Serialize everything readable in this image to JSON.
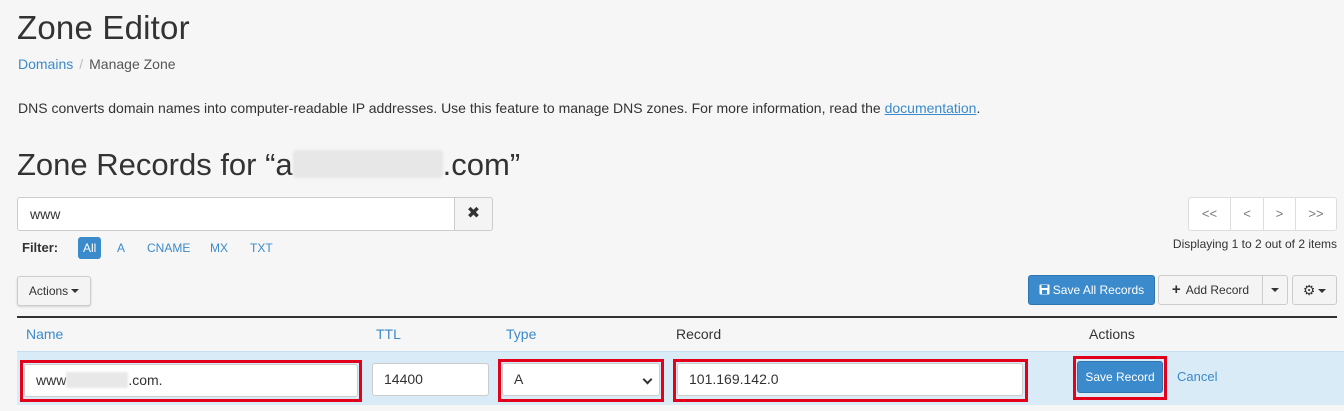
{
  "page": {
    "title": "Zone Editor",
    "breadcrumb": {
      "root": "Domains",
      "separator": "/",
      "current": "Manage Zone"
    },
    "description_prefix": "DNS converts domain names into computer-readable IP addresses. Use this feature to manage DNS zones. For more information, read the ",
    "description_link": "documentation",
    "description_suffix": ".",
    "zone_heading_prefix": "Zone Records for “a",
    "zone_heading_suffix": ".com”"
  },
  "search": {
    "value": "www",
    "clear_icon": "✖"
  },
  "filter": {
    "label": "Filter:",
    "options": [
      "All",
      "A",
      "CNAME",
      "MX",
      "TXT"
    ],
    "active": "All"
  },
  "pagination": {
    "first": "<<",
    "prev": "<",
    "next": ">",
    "last": ">>",
    "display_text": "Displaying 1 to 2 out of 2 items"
  },
  "toolbar": {
    "actions_label": "Actions",
    "save_all_label": "Save All Records",
    "add_record_label": "Add Record",
    "add_record_icon": "+",
    "settings_icon": "⚙"
  },
  "table": {
    "headers": {
      "name": "Name",
      "ttl": "TTL",
      "type": "Type",
      "record": "Record",
      "actions": "Actions"
    },
    "edit_row": {
      "name_prefix": "www",
      "name_suffix": ".com.",
      "ttl": "14400",
      "type": "A",
      "record": "101.169.142.0",
      "save_label": "Save Record",
      "cancel_label": "Cancel"
    }
  },
  "colors": {
    "accent": "#3b8acb",
    "highlight": "#e3001b",
    "row_bg": "#d9ebf7"
  }
}
